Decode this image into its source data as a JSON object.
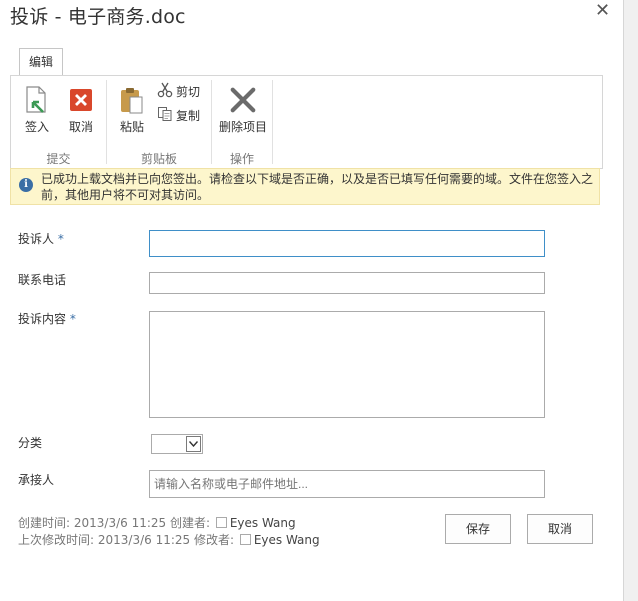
{
  "dialog": {
    "title": "投诉 - 电子商务.doc",
    "close_icon": "close-icon"
  },
  "ribbon": {
    "tab_label": "编辑",
    "groups": {
      "submit": {
        "label": "提交",
        "checkin_label": "签入",
        "cancel_label": "取消"
      },
      "clipboard": {
        "label": "剪贴板",
        "paste_label": "粘贴",
        "cut_label": "剪切",
        "copy_label": "复制"
      },
      "actions": {
        "label": "操作",
        "delete_label": "删除项目"
      }
    },
    "colors": {
      "cancel_red": "#d9472b",
      "checkin_green": "#3b9a54",
      "delete_gray": "#6b6b6b"
    }
  },
  "info_bar": {
    "icon": "info-icon",
    "message": "已成功上载文档并已向您签出。请检查以下域是否正确，以及是否已填写任何需要的域。文件在您签入之前，其他用户将不可对其访问。"
  },
  "form": {
    "complainant": {
      "label": "投诉人",
      "required": "*",
      "value": ""
    },
    "phone": {
      "label": "联系电话",
      "value": ""
    },
    "content": {
      "label": "投诉内容",
      "required": "*",
      "value": ""
    },
    "category": {
      "label": "分类",
      "value": ""
    },
    "assignee": {
      "label": "承接人",
      "placeholder": "请输入名称或电子邮件地址..."
    }
  },
  "meta": {
    "created_prefix": "创建时间: 2013/3/6 11:25  创建者: ",
    "created_by": "Eyes Wang",
    "modified_prefix": "上次修改时间: 2013/3/6 11:25  修改者: ",
    "modified_by": "Eyes Wang"
  },
  "buttons": {
    "save": "保存",
    "cancel": "取消"
  }
}
